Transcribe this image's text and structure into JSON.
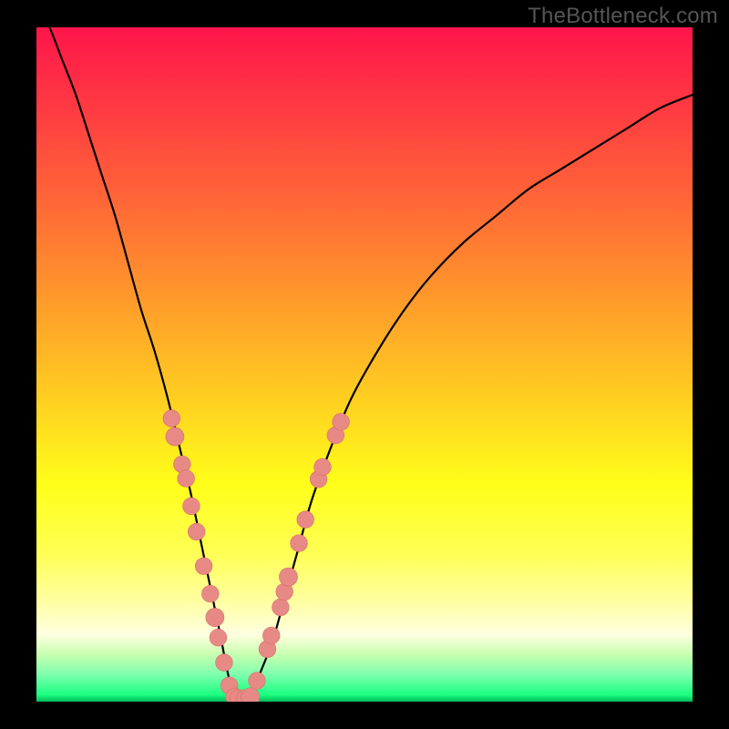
{
  "attribution": "TheBottleneck.com",
  "colors": {
    "curve": "#000000",
    "marker_fill": "#e78a86",
    "marker_stroke": "#d96f6b",
    "gradient_top": "#ff154a",
    "gradient_bottom": "#00b85a",
    "frame": "#000000"
  },
  "chart_data": {
    "type": "line",
    "title": "",
    "xlabel": "",
    "ylabel": "",
    "xlim": [
      0,
      100
    ],
    "ylim": [
      0,
      100
    ],
    "grid": false,
    "legend": false,
    "series": [
      {
        "name": "bottleneck-curve",
        "x": [
          0,
          2,
          4,
          6,
          8,
          10,
          12,
          14,
          16,
          18,
          20,
          22,
          23.5,
          25,
          26.5,
          28,
          29,
          30,
          31,
          32,
          33,
          34,
          36,
          38,
          40,
          42,
          45,
          48,
          52,
          56,
          60,
          65,
          70,
          75,
          80,
          85,
          90,
          95,
          100
        ],
        "y": [
          104,
          100,
          95,
          90,
          84,
          78,
          72,
          65,
          58,
          52,
          45,
          37,
          31,
          24,
          17,
          10,
          5,
          1,
          0,
          0,
          1,
          4,
          9,
          16,
          23,
          30,
          38,
          45,
          52,
          58,
          63,
          68,
          72,
          76,
          79,
          82,
          85,
          88,
          90
        ]
      }
    ],
    "markers": [
      {
        "x": 20.6,
        "y": 42.0,
        "r": 1.3
      },
      {
        "x": 21.1,
        "y": 39.3,
        "r": 1.4
      },
      {
        "x": 22.2,
        "y": 35.2,
        "r": 1.3
      },
      {
        "x": 22.8,
        "y": 33.1,
        "r": 1.3
      },
      {
        "x": 23.6,
        "y": 29.0,
        "r": 1.3
      },
      {
        "x": 24.4,
        "y": 25.2,
        "r": 1.3
      },
      {
        "x": 25.5,
        "y": 20.1,
        "r": 1.3
      },
      {
        "x": 26.5,
        "y": 16.0,
        "r": 1.3
      },
      {
        "x": 27.2,
        "y": 12.5,
        "r": 1.4
      },
      {
        "x": 27.7,
        "y": 9.5,
        "r": 1.3
      },
      {
        "x": 28.6,
        "y": 5.8,
        "r": 1.3
      },
      {
        "x": 29.4,
        "y": 2.4,
        "r": 1.3
      },
      {
        "x": 30.2,
        "y": 0.7,
        "r": 1.35
      },
      {
        "x": 30.8,
        "y": 0.5,
        "r": 1.3
      },
      {
        "x": 31.8,
        "y": 0.5,
        "r": 1.3
      },
      {
        "x": 32.6,
        "y": 0.7,
        "r": 1.4
      },
      {
        "x": 33.6,
        "y": 3.1,
        "r": 1.3
      },
      {
        "x": 35.2,
        "y": 7.8,
        "r": 1.3
      },
      {
        "x": 35.8,
        "y": 9.8,
        "r": 1.3
      },
      {
        "x": 37.2,
        "y": 14.0,
        "r": 1.3
      },
      {
        "x": 37.8,
        "y": 16.3,
        "r": 1.3
      },
      {
        "x": 38.4,
        "y": 18.5,
        "r": 1.4
      },
      {
        "x": 40.0,
        "y": 23.5,
        "r": 1.3
      },
      {
        "x": 41.0,
        "y": 27.0,
        "r": 1.3
      },
      {
        "x": 43.0,
        "y": 33.0,
        "r": 1.3
      },
      {
        "x": 43.6,
        "y": 34.8,
        "r": 1.3
      },
      {
        "x": 45.6,
        "y": 39.5,
        "r": 1.3
      },
      {
        "x": 46.4,
        "y": 41.5,
        "r": 1.3
      }
    ]
  }
}
